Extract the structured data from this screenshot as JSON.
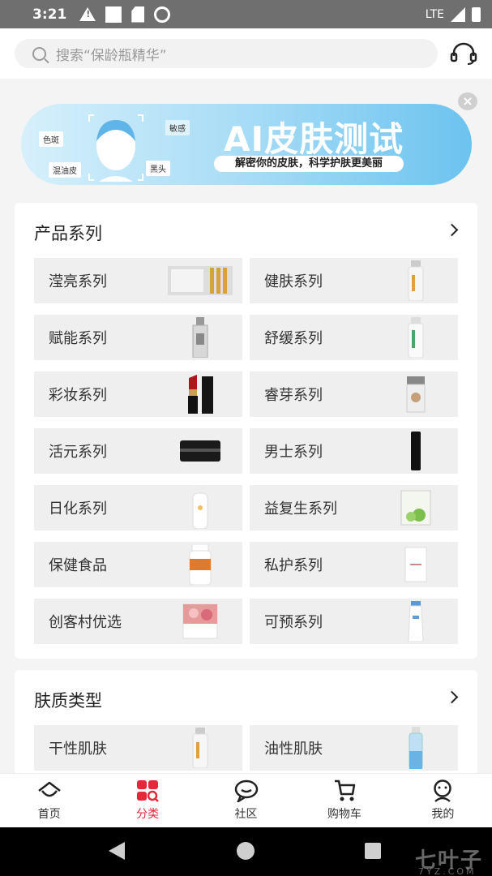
{
  "status_bar": {
    "time": "3:21",
    "network": "LTE"
  },
  "search": {
    "placeholder": "搜索“保龄瓶精华”"
  },
  "banner": {
    "title": "AI皮肤测试",
    "subtitle": "解密你的皮肤，科学护肤更美丽",
    "tags": [
      "色斑",
      "敏感",
      "混油皮",
      "黑头"
    ],
    "close": "×"
  },
  "product_series": {
    "title": "产品系列",
    "items": [
      {
        "label": "滢亮系列",
        "image": "ampoule-box"
      },
      {
        "label": "健肤系列",
        "image": "spray-bottle"
      },
      {
        "label": "赋能系列",
        "image": "serum-bottle"
      },
      {
        "label": "舒缓系列",
        "image": "lotion-bottle"
      },
      {
        "label": "彩妆系列",
        "image": "lipstick"
      },
      {
        "label": "睿芽系列",
        "image": "cream-jar"
      },
      {
        "label": "活元系列",
        "image": "black-jar"
      },
      {
        "label": "男士系列",
        "image": "black-bottle"
      },
      {
        "label": "日化系列",
        "image": "pump-bottle"
      },
      {
        "label": "益复生系列",
        "image": "green-box"
      },
      {
        "label": "保健食品",
        "image": "supplement-bottle"
      },
      {
        "label": "私护系列",
        "image": "white-box"
      },
      {
        "label": "创客村优选",
        "image": "pink-box"
      },
      {
        "label": "可预系列",
        "image": "tube"
      }
    ]
  },
  "skin_types": {
    "title": "肤质类型",
    "items": [
      {
        "label": "干性肌肤",
        "image": "spray-bottle"
      },
      {
        "label": "油性肌肤",
        "image": "blue-bottle"
      }
    ]
  },
  "bottom_nav": [
    {
      "label": "首页",
      "icon": "home-icon",
      "active": false
    },
    {
      "label": "分类",
      "icon": "category-icon",
      "active": true
    },
    {
      "label": "社区",
      "icon": "community-icon",
      "active": false
    },
    {
      "label": "购物车",
      "icon": "cart-icon",
      "active": false
    },
    {
      "label": "我的",
      "icon": "profile-icon",
      "active": false
    }
  ],
  "watermark": {
    "text": "七叶子",
    "sub": "7YZ.COM"
  },
  "colors": {
    "accent": "#e8263a",
    "banner_start": "#d6f0fb",
    "banner_end": "#6cc3ef"
  }
}
